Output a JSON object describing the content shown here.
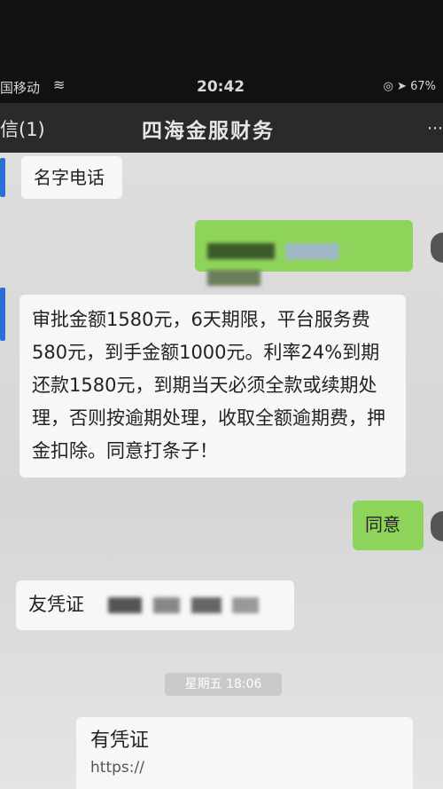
{
  "status": {
    "carrier": "国移动",
    "time": "20:42",
    "battery": "67%"
  },
  "header": {
    "back_label": "信(1)",
    "title": "四海金服财务",
    "menu_icon": "more-icon"
  },
  "messages": [
    {
      "side": "left",
      "text": "名字电话"
    },
    {
      "side": "right",
      "text": "",
      "blurred": true
    },
    {
      "side": "left",
      "text": "审批金额1580元，6天期限，平台服务费580元，到手金额1000元。利率24%到期还款1580元，到期当天必须全款或续期处理，否则按逾期处理，收取全额逾期费，押金扣除。同意打条子！"
    },
    {
      "side": "right",
      "text": "同意"
    },
    {
      "side": "left",
      "text": "友凭证"
    }
  ],
  "timestamp": "星期五 18:06",
  "last_message": {
    "title": "有凭证",
    "link": "https://"
  },
  "colors": {
    "green_bubble": "#8fd45a",
    "white_bubble": "#f7f7f7",
    "title_bar": "#2a2a2c"
  }
}
